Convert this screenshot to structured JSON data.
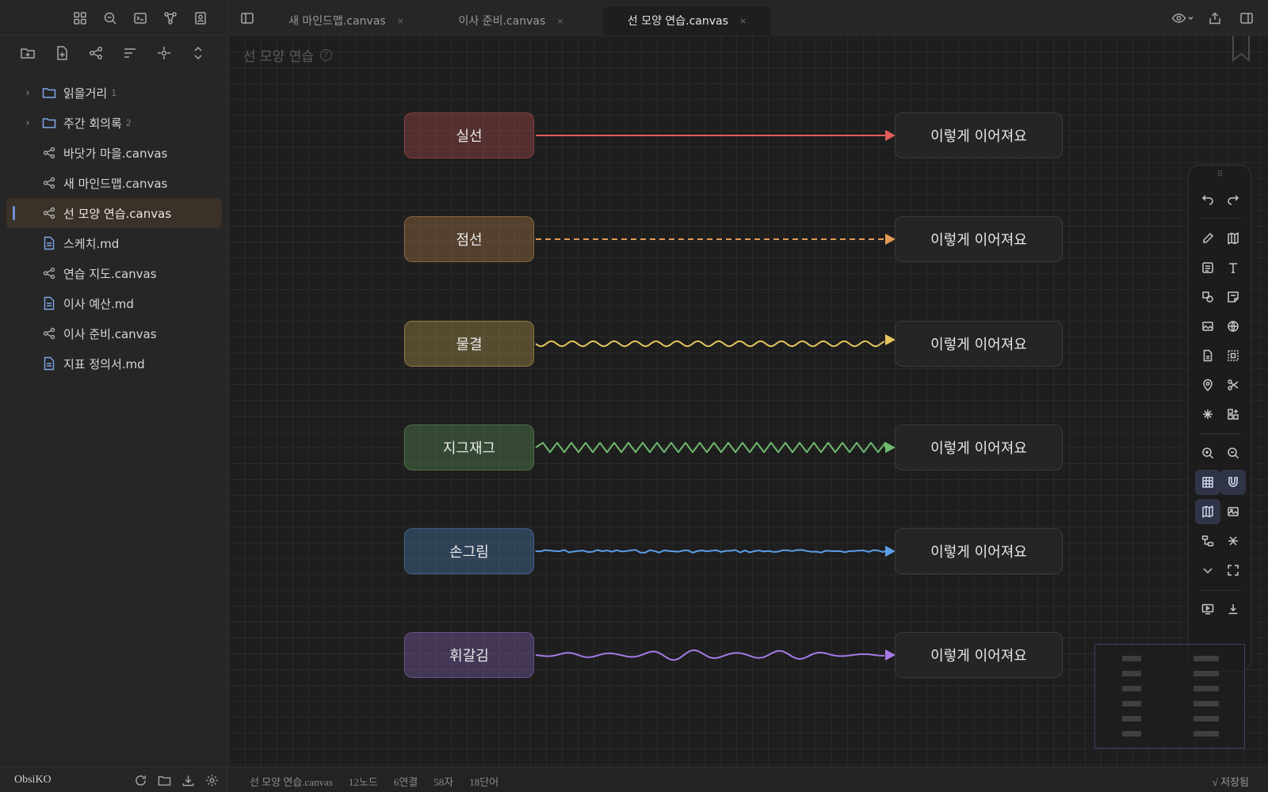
{
  "sidebar": {
    "ribbon_icons": [
      "layout-grid-icon",
      "search-file-icon",
      "terminal-icon",
      "graph-icon",
      "contact-card-icon"
    ],
    "nav_actions": [
      "new-folder-icon",
      "new-file-icon",
      "new-canvas-icon",
      "sort-icon",
      "locate-icon",
      "collapse-icon"
    ],
    "items": [
      {
        "label": "읽을거리",
        "type": "folder",
        "count": "1"
      },
      {
        "label": "주간 회의록",
        "type": "folder",
        "count": "2"
      },
      {
        "label": "바닷가 마을.canvas",
        "type": "canvas"
      },
      {
        "label": "새 마인드맵.canvas",
        "type": "canvas"
      },
      {
        "label": "선 모양 연습.canvas",
        "type": "canvas",
        "active": true
      },
      {
        "label": "스케치.md",
        "type": "md"
      },
      {
        "label": "연습 지도.canvas",
        "type": "canvas"
      },
      {
        "label": "이사 예산.md",
        "type": "md"
      },
      {
        "label": "이사 준비.canvas",
        "type": "canvas"
      },
      {
        "label": "지표 정의서.md",
        "type": "md"
      }
    ],
    "vault_name": "ObsiKO",
    "footer_icons": [
      "refresh-icon",
      "folder-icon",
      "download-icon",
      "settings-icon"
    ]
  },
  "tabs": [
    {
      "label": "새 마인드맵.canvas",
      "close": "×"
    },
    {
      "label": "이사 준비.canvas",
      "close": "×"
    },
    {
      "label": "선 모양 연습.canvas",
      "close": "×",
      "active": true
    }
  ],
  "canvas": {
    "title": "선 모양 연습",
    "help": "?",
    "nodes": [
      {
        "label": "실선",
        "target": "이렇게 이어져요",
        "color": "#e05c5c",
        "style": "solid"
      },
      {
        "label": "점선",
        "target": "이렇게 이어져요",
        "color": "#e49a55",
        "style": "dashed"
      },
      {
        "label": "물결",
        "target": "이렇게 이어져요",
        "color": "#e6c65c",
        "style": "wavy"
      },
      {
        "label": "지그재그",
        "target": "이렇게 이어져요",
        "color": "#6fb86d",
        "style": "zigzag"
      },
      {
        "label": "손그림",
        "target": "이렇게 이어져요",
        "color": "#5b9ee6",
        "style": "handdrawn"
      },
      {
        "label": "휘갈김",
        "target": "이렇게 이어져요",
        "color": "#a47ae6",
        "style": "scribble"
      }
    ]
  },
  "toolbar_icons": [
    "undo-icon",
    "redo-icon",
    "pencil-icon",
    "map-icon",
    "text-card-icon",
    "text-icon",
    "shapes-icon",
    "sticky-note-icon",
    "image-icon",
    "globe-icon",
    "file-icon",
    "selection-icon",
    "pin-icon",
    "scissors-icon",
    "sparkle-icon",
    "widgets-icon",
    "zoom-in-icon",
    "zoom-out-icon",
    "grid-icon",
    "magnet-icon",
    "map-view-icon",
    "image-view-icon",
    "connect-icon",
    "collapse-edges-icon",
    "chevron-down-icon",
    "fullscreen-icon",
    "present-icon",
    "export-icon"
  ],
  "status": {
    "file": "선 모양 연습.canvas",
    "nodes": "12노드",
    "edges": "6연결",
    "chars": "58자",
    "words": "18단어",
    "saved": "√ 저장됨"
  }
}
